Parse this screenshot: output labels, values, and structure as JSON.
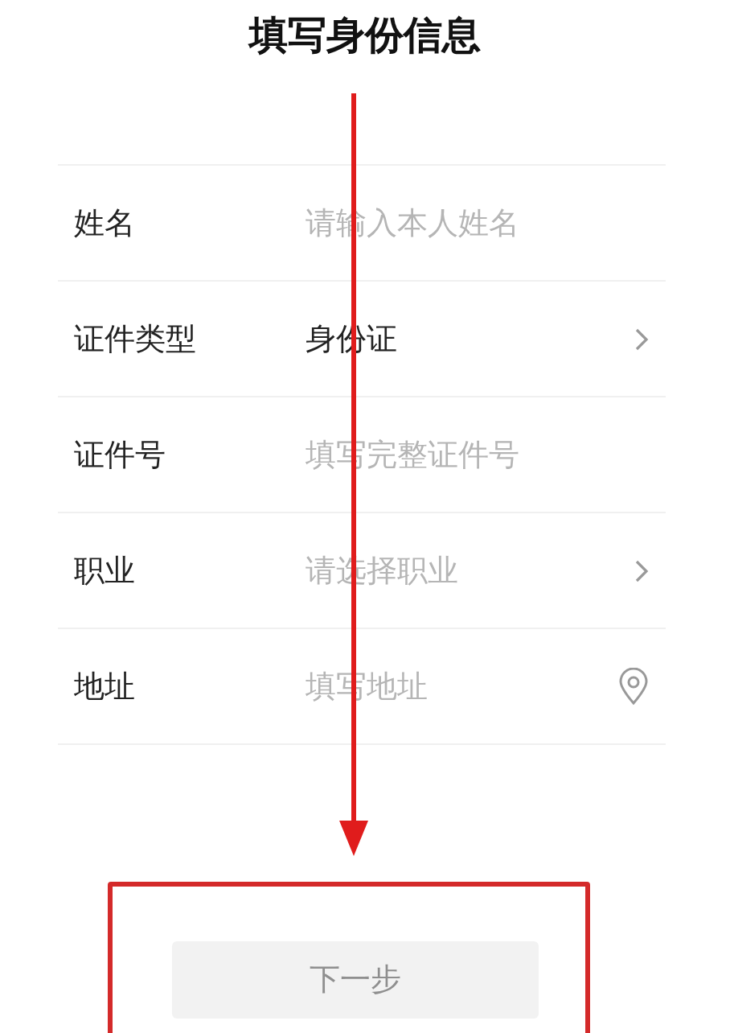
{
  "title": "填写身份信息",
  "rows": [
    {
      "label": "姓名",
      "kind": "input",
      "placeholder": "请输入本人姓名"
    },
    {
      "label": "证件类型",
      "kind": "select",
      "value": "身份证"
    },
    {
      "label": "证件号",
      "kind": "input",
      "placeholder": "填写完整证件号"
    },
    {
      "label": "职业",
      "kind": "select",
      "placeholder": "请选择职业"
    },
    {
      "label": "地址",
      "kind": "location",
      "placeholder": "填写地址"
    }
  ],
  "next_button": {
    "label": "下一步",
    "disabled": true
  },
  "annotations": {
    "arrow": true,
    "highlight_frame": true
  }
}
